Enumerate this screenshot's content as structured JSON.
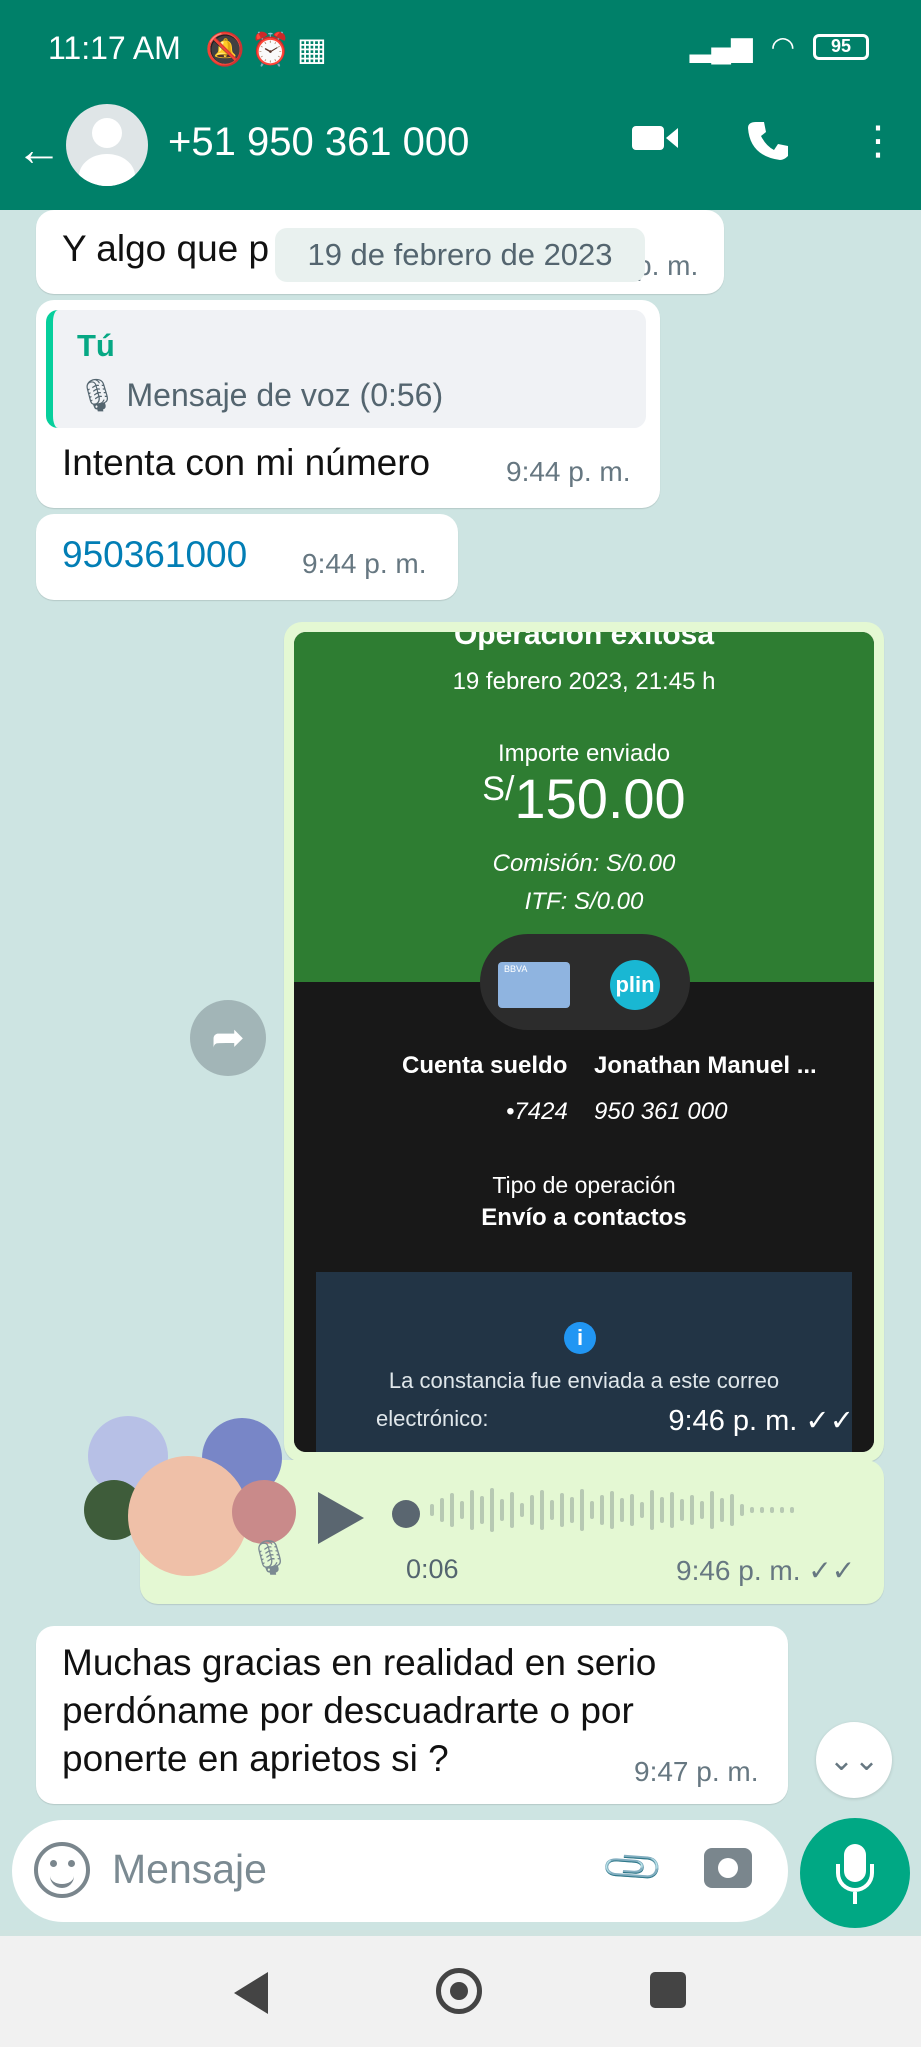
{
  "status_bar": {
    "time": "11:17 AM",
    "icons": "🔕⏰▦",
    "battery": "95"
  },
  "header": {
    "title": "+51 950 361 000",
    "back_icon": "←",
    "video_icon": "video-camera",
    "call_icon": "phone",
    "menu_icon": "⋮"
  },
  "chat": {
    "date_label": "19 de febrero de 2023",
    "messages": [
      {
        "text": "Y algo que p",
        "time": "p. m."
      },
      {
        "quote_author": "Tú",
        "quote_text": "Mensaje de voz (0:56)",
        "text": "Intenta con mi número",
        "time": "9:44 p. m."
      },
      {
        "text": "950361000",
        "time": "9:44 p. m."
      }
    ],
    "image_message": {
      "title_partial": "Operación exitosa",
      "date": "19 febrero 2023, 21:45 h",
      "amount_label": "Importe enviado",
      "currency": "S/",
      "amount": "150.00",
      "commission": "Comisión:  S/0.00",
      "itf": "ITF:  S/0.00",
      "account_from": "Cuenta sueldo",
      "account_from_num": "•7424",
      "account_to": "Jonathan Manuel ...",
      "account_to_num": "950 361 000",
      "op_type_label": "Tipo de operación",
      "op_type": "Envío a contactos",
      "notice": "La constancia fue enviada a este correo",
      "notice2": "electrónico:",
      "plin": "plin",
      "bank_card": "BBVA",
      "time": "9:46 p. m. ✓✓"
    },
    "voice_message": {
      "duration": "0:06",
      "time": "9:46 p. m. ✓✓"
    },
    "last_message": {
      "line1": "Muchas gracias en realidad en serio",
      "line2": "perdóname por descuadrarte o por",
      "line3": "ponerte en aprietos si ?",
      "time": "9:47 p. m."
    }
  },
  "input": {
    "placeholder": "Mensaje"
  }
}
